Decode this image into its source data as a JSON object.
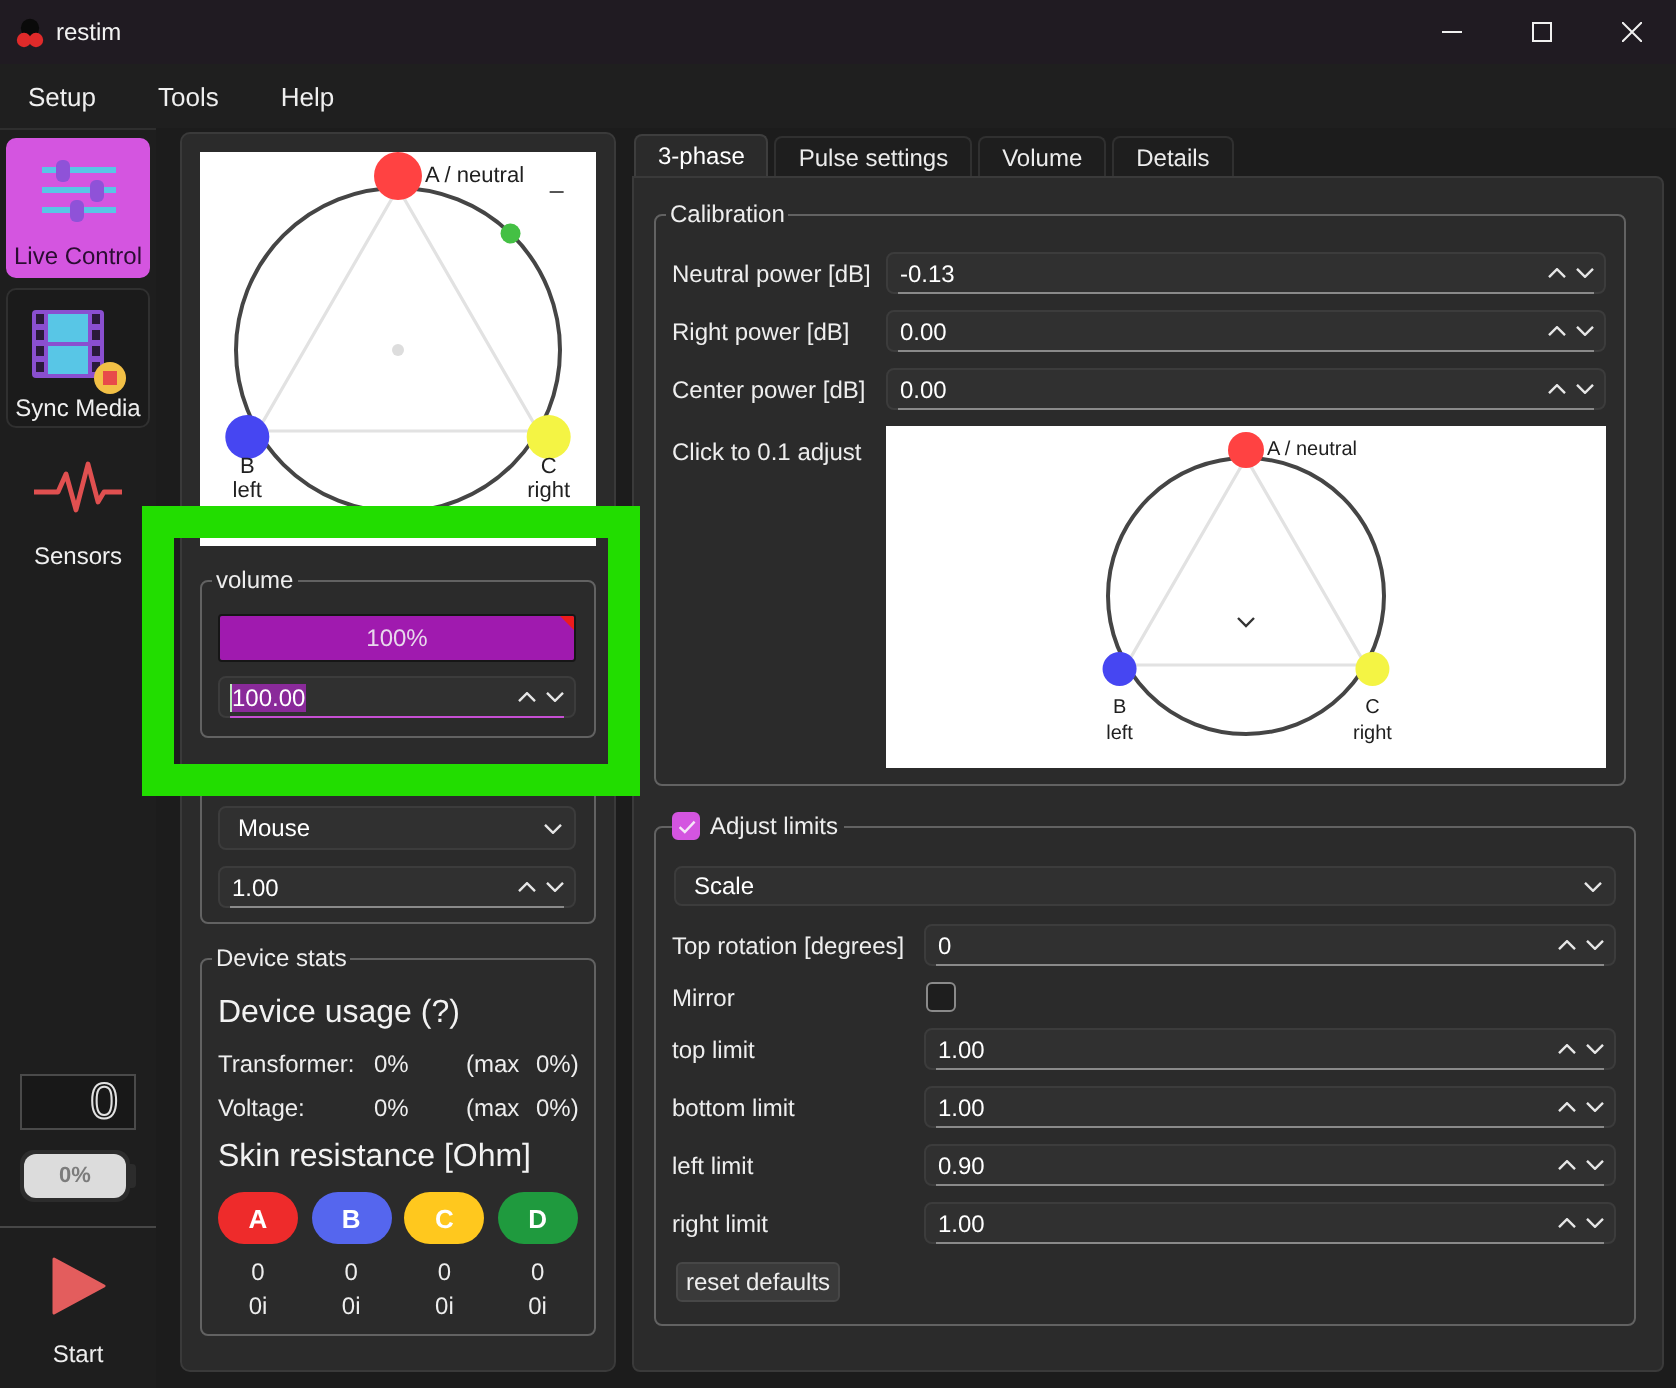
{
  "window": {
    "title": "restim"
  },
  "menu": [
    "Setup",
    "Tools",
    "Help"
  ],
  "sidebar": {
    "items": [
      {
        "kind": "sliders",
        "label": "Live Control",
        "selected": true,
        "hovered": false
      },
      {
        "kind": "film",
        "label": "Sync Media",
        "selected": false,
        "hovered": true
      },
      {
        "kind": "pulse",
        "label": "Sensors",
        "selected": false,
        "hovered": false
      }
    ],
    "counter": "0",
    "battery": "0%",
    "start": "Start"
  },
  "phase_panel": {
    "corner_mark": "_",
    "electrodes": [
      {
        "label": "A / neutral",
        "color": "#ff4242"
      },
      {
        "label": "B",
        "sublabel": "left",
        "color": "#4646f2"
      },
      {
        "label": "C",
        "sublabel": "right",
        "color": "#f4f444"
      }
    ]
  },
  "volume": {
    "title": "volume",
    "level": 1,
    "reading": "100%",
    "value": "100.00",
    "focused": true,
    "highlighted": true
  },
  "control": {
    "mode": "Mouse",
    "value": "1.00"
  },
  "device_stats": {
    "title": "Device stats",
    "usage_title": "Device usage (?)",
    "rows": [
      {
        "label": "Transformer:",
        "value": "0%",
        "max_label": "(max",
        "max_value": "0%)"
      },
      {
        "label": "Voltage:",
        "value": "0%",
        "max_label": "(max",
        "max_value": "0%)"
      }
    ],
    "skin_title": "Skin resistance [Ohm]",
    "channels": [
      {
        "label": "A",
        "color": "#ee2b2b",
        "value": "0",
        "imaginary": "0i"
      },
      {
        "label": "B",
        "color": "#5566ee",
        "value": "0",
        "imaginary": "0i"
      },
      {
        "label": "C",
        "color": "#ffc81e",
        "value": "0",
        "imaginary": "0i"
      },
      {
        "label": "D",
        "color": "#1f9a3e",
        "value": "0",
        "imaginary": "0i"
      }
    ]
  },
  "tabs": [
    {
      "label": "3-phase",
      "selected": true
    },
    {
      "label": "Pulse settings",
      "selected": false
    },
    {
      "label": "Volume",
      "selected": false
    },
    {
      "label": "Details",
      "selected": false
    }
  ],
  "calibration": {
    "title": "Calibration",
    "rows": [
      {
        "label": "Neutral power [dB]",
        "value": "-0.13"
      },
      {
        "label": "Right power [dB]",
        "value": "0.00"
      },
      {
        "label": "Center power [dB]",
        "value": "0.00"
      }
    ],
    "hint": "Click to 0.1 adjust",
    "electrodes": [
      {
        "label": "A / neutral",
        "color": "#ff4242"
      },
      {
        "label": "B",
        "sublabel": "left",
        "color": "#4646f2"
      },
      {
        "label": "C",
        "sublabel": "right",
        "color": "#f4f444"
      }
    ]
  },
  "limits": {
    "title": "Adjust limits",
    "checked": true,
    "mode": "Scale",
    "rows": [
      {
        "kind": "spin",
        "label": "Top rotation [degrees]",
        "value": "0"
      },
      {
        "kind": "checkbox",
        "label": "Mirror",
        "checked": false
      },
      {
        "kind": "spin",
        "label": "top limit",
        "value": "1.00"
      },
      {
        "kind": "spin",
        "label": "bottom limit",
        "value": "1.00"
      },
      {
        "kind": "spin",
        "label": "left limit",
        "value": "0.90"
      },
      {
        "kind": "spin",
        "label": "right limit",
        "value": "1.00"
      }
    ],
    "reset": "reset defaults"
  }
}
